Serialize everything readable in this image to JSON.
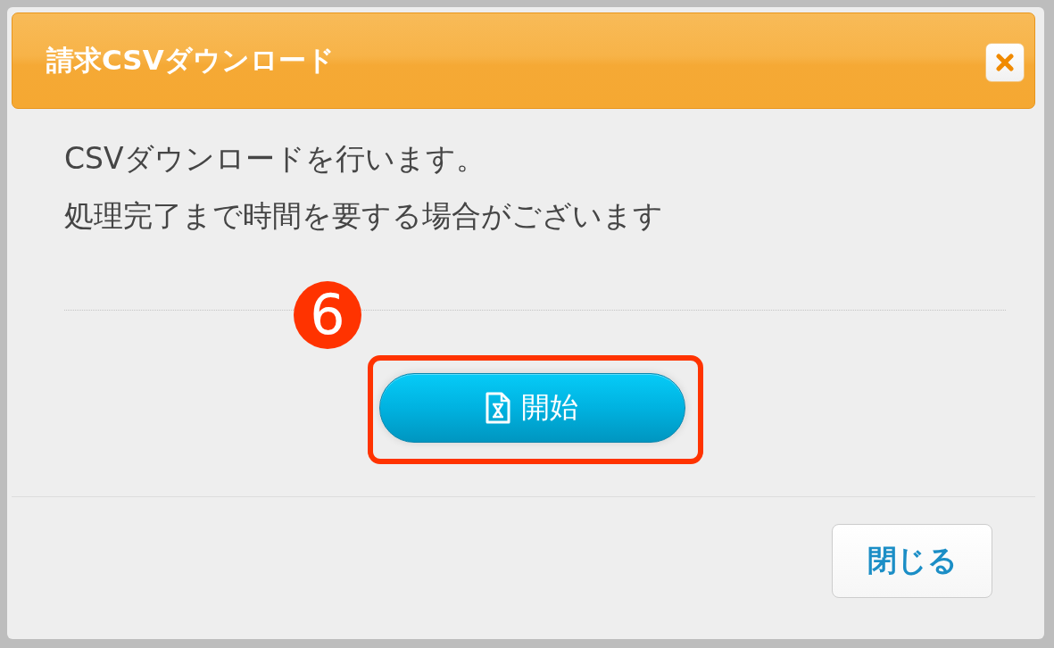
{
  "dialog": {
    "title": "請求CSVダウンロード",
    "message_lines": [
      "CSVダウンロードを行います。",
      "処理完了まで時間を要する場合がございます"
    ],
    "start_button": {
      "label": "開始"
    },
    "footer": {
      "close_button": {
        "label": "閉じる"
      }
    }
  },
  "annotation": {
    "number": "6",
    "framed": true
  }
}
